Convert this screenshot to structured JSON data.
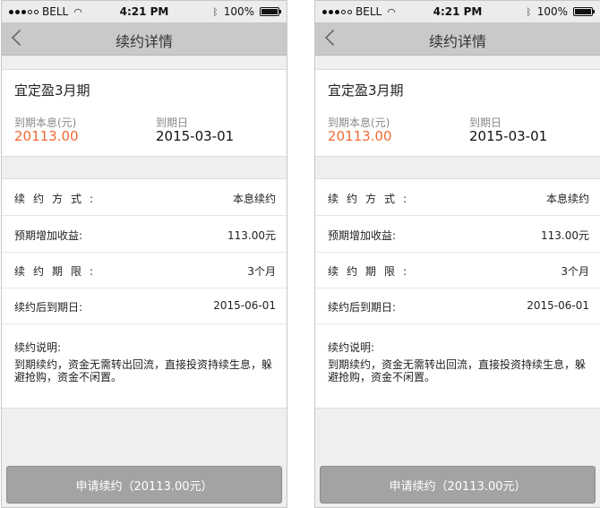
{
  "status": {
    "carrier": "BELL",
    "time": "4:21 PM",
    "battery": "100%"
  },
  "nav": {
    "title": "续约详情"
  },
  "product": {
    "name": "宜定盈3月期",
    "principal_label": "到期本息(元)",
    "principal_value": "20113.00",
    "due_label": "到期日",
    "due_value": "2015-03-01",
    "accent_color": "#f06a35"
  },
  "details": [
    {
      "key": "续约方式:",
      "value": "本息续约"
    },
    {
      "key": "预期增加收益:",
      "value": "113.00元"
    },
    {
      "key": "续约期限:",
      "value": "3个月"
    },
    {
      "key": "续约后到期日:",
      "value": "2015-06-01"
    }
  ],
  "description": {
    "title": "续约说明:",
    "text": "到期续约，资金无需转出回流，直接投资持续生息，躲避抢购，资金不闲置。"
  },
  "apply_button": {
    "label": "申请续约（20113.00元）"
  },
  "icons": [
    "back-arrow-icon",
    "wifi-icon",
    "bluetooth-icon",
    "battery-icon"
  ]
}
